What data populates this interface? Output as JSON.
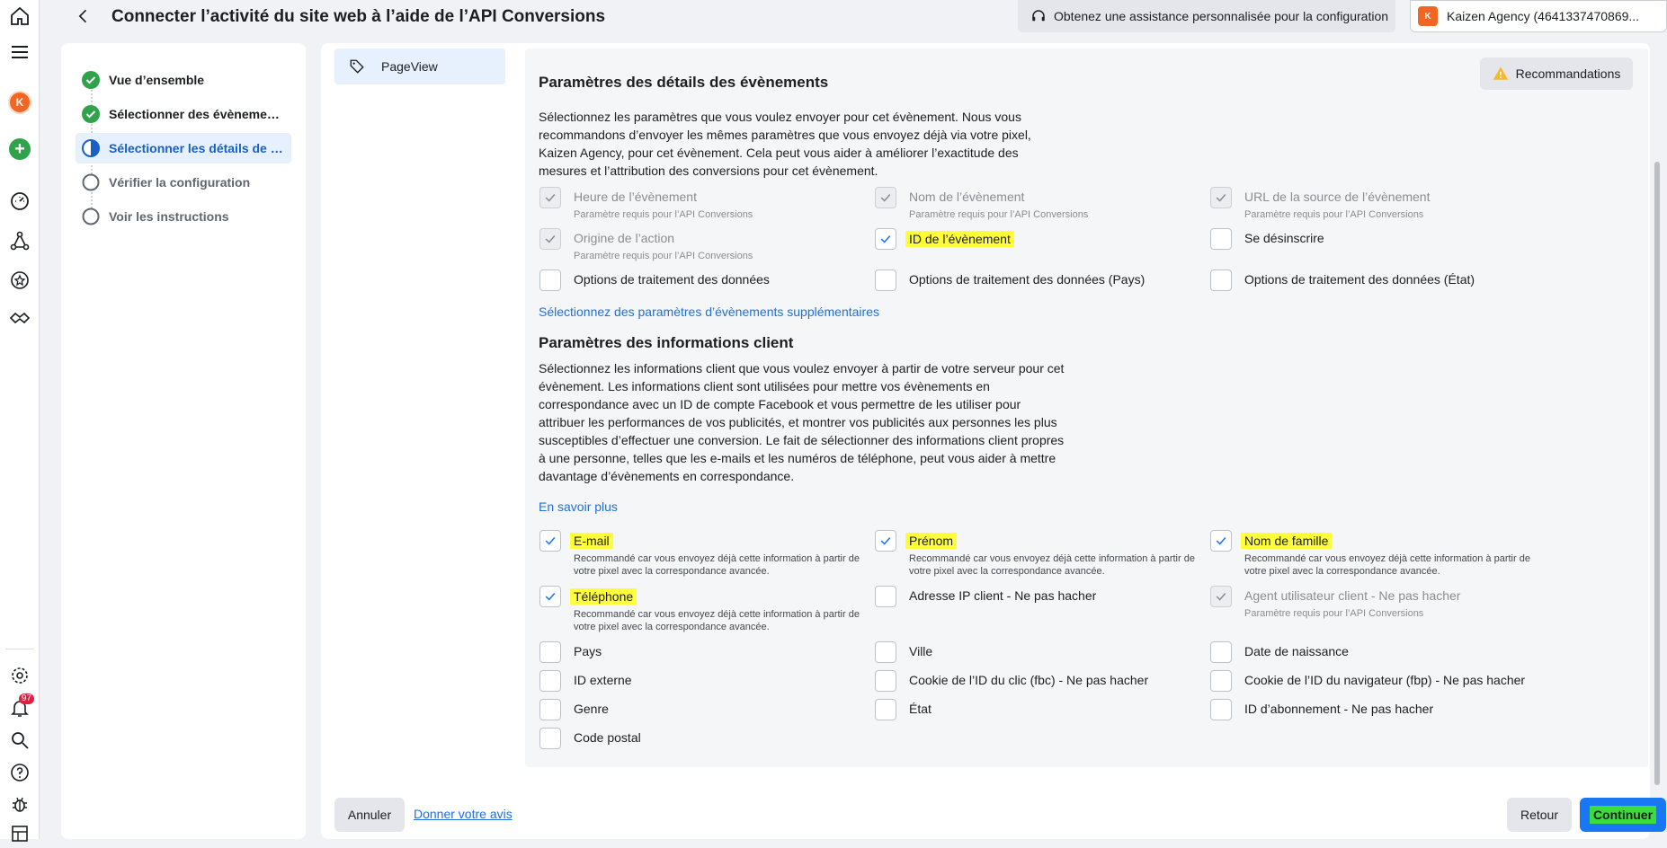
{
  "header": {
    "title": "Connecter l’activité du site web à l’aide de l’API Conversions",
    "assistance": "Obtenez une assistance personnalisée pour la configuration",
    "account": "Kaizen Agency (4641337470869..."
  },
  "rail": {
    "notifications_count": "97"
  },
  "steps": [
    {
      "label": "Vue d’ensemble",
      "state": "done"
    },
    {
      "label": "Sélectionner des évènements",
      "state": "done"
    },
    {
      "label": "Sélectionner les détails de l’é...",
      "state": "active"
    },
    {
      "label": "Vérifier la configuration",
      "state": "todo"
    },
    {
      "label": "Voir les instructions",
      "state": "todo"
    }
  ],
  "event": {
    "name": "PageView"
  },
  "event_params": {
    "title": "Paramètres des détails des évènements",
    "recommendations": "Recommandations",
    "description": "Sélectionnez les paramètres que vous voulez envoyer pour cet évènement. Nous vous recommandons d’envoyer les mêmes paramètres que vous envoyez déjà via votre pixel, Kaizen Agency, pour cet évènement. Cela peut vous aider à améliorer l’exactitude des mesures et l’attribution des conversions pour cet évènement.",
    "required_note": "Paramètre requis pour l’API Conversions",
    "items": [
      {
        "label": "Heure de l’évènement",
        "sub": "Paramètre requis pour l’API Conversions"
      },
      {
        "label": "Nom de l’évènement",
        "sub": "Paramètre requis pour l’API Conversions"
      },
      {
        "label": "URL de la source de l’évènement",
        "sub": "Paramètre requis pour l’API Conversions"
      },
      {
        "label": "Origine de l’action",
        "sub": "Paramètre requis pour l’API Conversions"
      },
      {
        "label": "ID de l’évènement"
      },
      {
        "label": "Se désinscrire"
      },
      {
        "label": "Options de traitement des données"
      },
      {
        "label": "Options de traitement des données (Pays)"
      },
      {
        "label": "Options de traitement des données (État)"
      }
    ],
    "more_link": "Sélectionnez des paramètres d’évènements supplémentaires"
  },
  "customer_info": {
    "title": "Paramètres des informations client",
    "description": "Sélectionnez les informations client que vous voulez envoyer à partir de votre serveur pour cet évènement. Les informations client sont utilisées pour mettre vos évènements en correspondance avec un ID de compte Facebook et vous permettre de les utiliser pour attribuer les performances de vos publicités, et montrer vos publicités aux personnes les plus susceptibles d’effectuer une conversion. Le fait de sélectionner des informations client propres à une personne, telles que les e-mails et les numéros de téléphone, peut vous aider à mettre davantage d’évènements en correspondance.",
    "learn_more": "En savoir plus",
    "recommended_note": "Recommandé car vous envoyez déjà cette information à partir de votre pixel avec la correspondance avancée.",
    "items": [
      {
        "label": "E-mail",
        "sub": "Recommandé car vous envoyez déjà cette information à partir de votre pixel avec la correspondance avancée."
      },
      {
        "label": "Prénom",
        "sub": "Recommandé car vous envoyez déjà cette information à partir de votre pixel avec la correspondance avancée."
      },
      {
        "label": "Nom de famille",
        "sub": "Recommandé car vous envoyez déjà cette information à partir de votre pixel avec la correspondance avancée."
      },
      {
        "label": "Téléphone",
        "sub": "Recommandé car vous envoyez déjà cette information à partir de votre pixel avec la correspondance avancée."
      },
      {
        "label": "Adresse IP client - Ne pas hacher"
      },
      {
        "label": "Agent utilisateur client - Ne pas hacher",
        "sub": "Paramètre requis pour l’API Conversions"
      },
      {
        "label": "Pays"
      },
      {
        "label": "Ville"
      },
      {
        "label": "Date de naissance"
      },
      {
        "label": "ID externe"
      },
      {
        "label": "Cookie de l’ID du clic (fbc) - Ne pas hacher"
      },
      {
        "label": "Cookie de l’ID du navigateur (fbp) - Ne pas hacher"
      },
      {
        "label": "Genre"
      },
      {
        "label": "État"
      },
      {
        "label": "ID d’abonnement - Ne pas hacher"
      },
      {
        "label": "Code postal"
      }
    ]
  },
  "footer": {
    "cancel": "Annuler",
    "feedback": "Donner votre avis",
    "back": "Retour",
    "continue": "Continuer"
  },
  "colors": {
    "accent": "#1877f2",
    "success": "#31a24c",
    "highlight": "#ffff3a",
    "continue_highlight": "#3ddc3d"
  }
}
